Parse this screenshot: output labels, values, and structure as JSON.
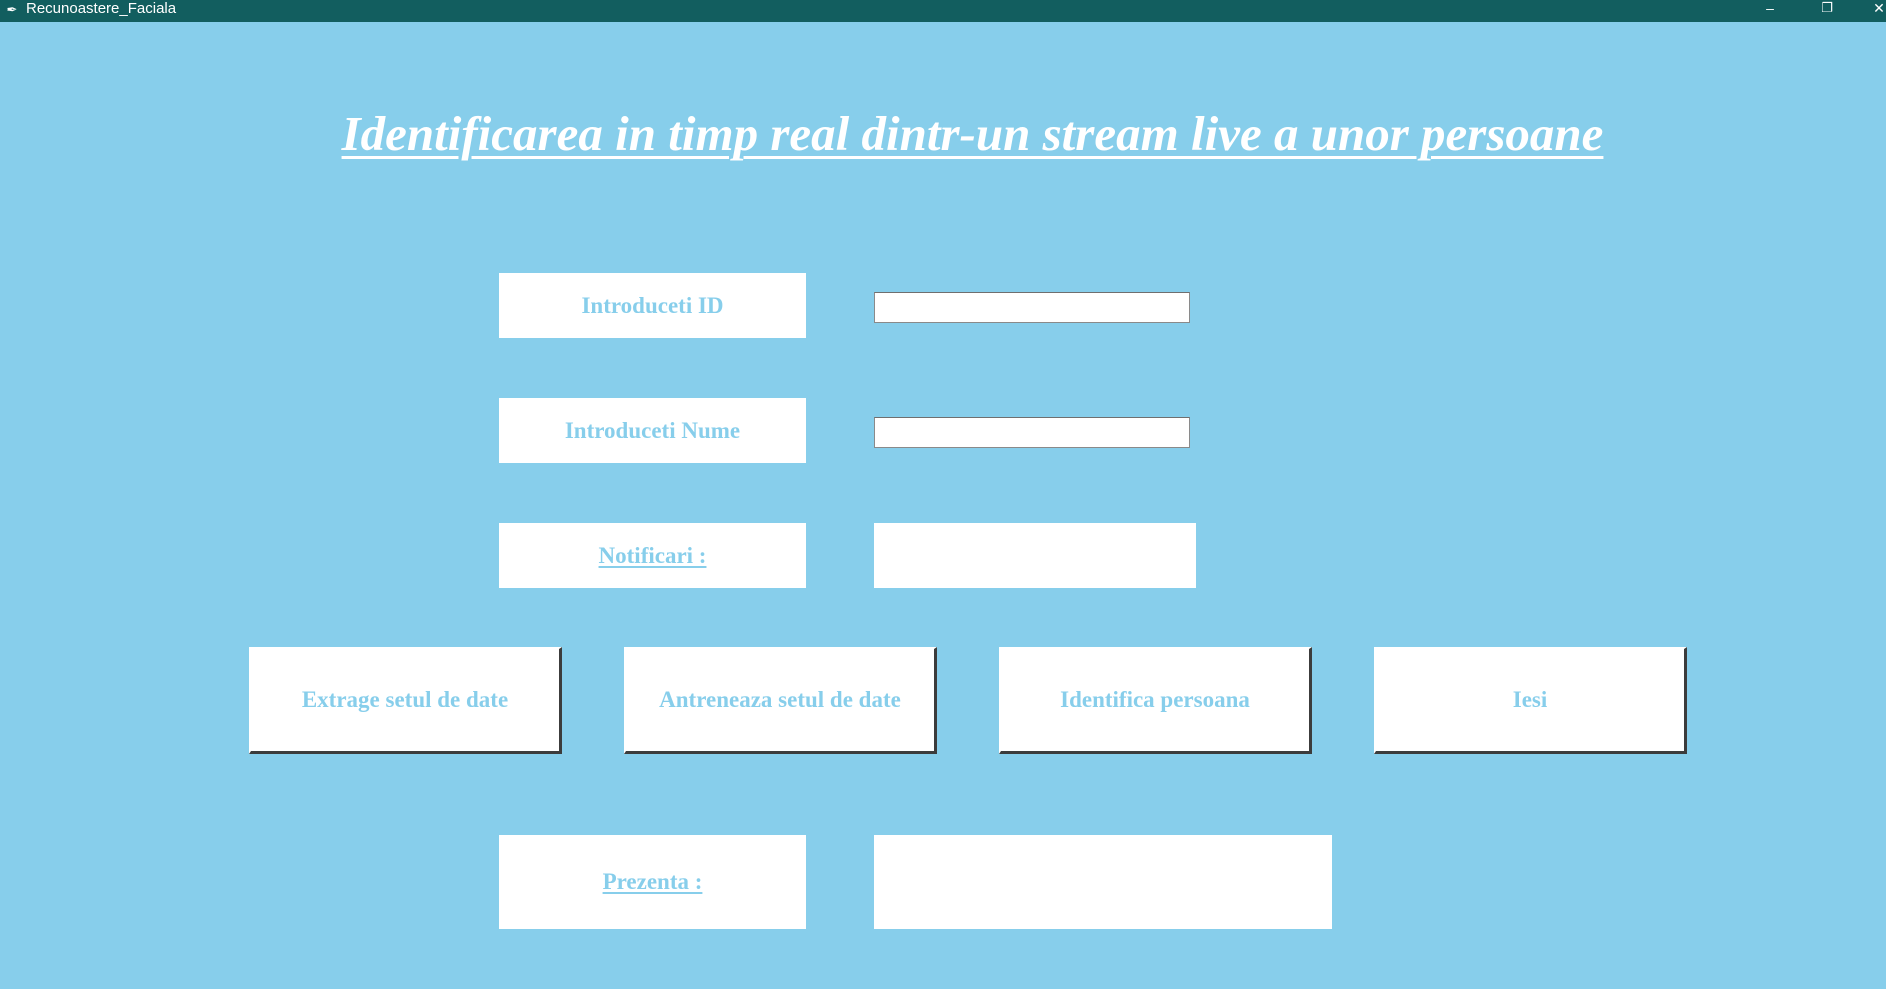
{
  "window": {
    "title": "Recunoastere_Faciala",
    "icon": "feather-icon",
    "minimize_glyph": "–",
    "maximize_glyph": "❐",
    "close_glyph": "✕"
  },
  "header": {
    "title": "Identificarea in timp real dintr-un stream live a unor persoane"
  },
  "form": {
    "id_label": "Introduceti ID",
    "id_value": "",
    "name_label": "Introduceti Nume",
    "name_value": "",
    "notifications_label": "Notificari : ",
    "notifications_text": "",
    "attendance_label": "Prezenta : ",
    "attendance_text": ""
  },
  "actions": {
    "extract_label": "Extrage setul de date",
    "train_label": "Antreneaza setul de date",
    "identify_label": "Identifica persoana",
    "exit_label": "Iesi"
  },
  "colors": {
    "background": "#87ceeb",
    "titlebar": "#125e5f",
    "accent_text": "#87ceeb",
    "panel": "#ffffff"
  }
}
